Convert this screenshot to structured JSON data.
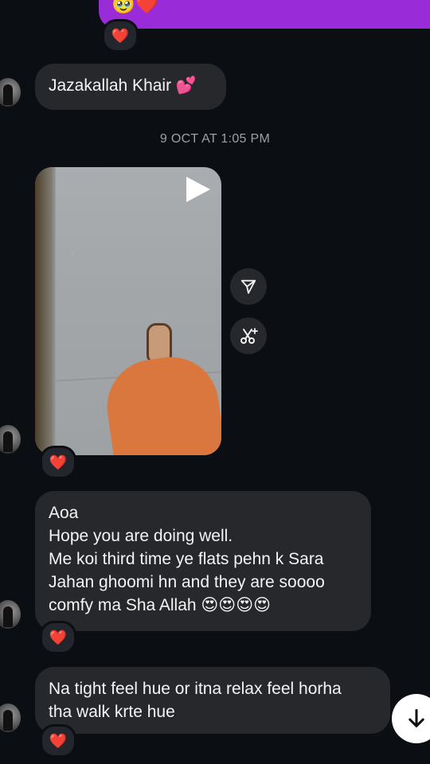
{
  "top_message": {
    "emojis": "🥹❤️"
  },
  "reaction": {
    "emoji": "❤️"
  },
  "messages": [
    {
      "lines": [
        "Jazakallah Khair 💕"
      ]
    },
    {
      "lines": [
        "Aoa",
        "Hope you are doing well.",
        "Me koi third time ye flats pehn k Sara",
        "Jahan ghoomi hn and they are soooo",
        "comfy ma Sha Allah 😍😍😍😍"
      ]
    },
    {
      "lines": [
        "Na tight feel hue or itna relax feel horha",
        "tha walk krte hue"
      ]
    }
  ],
  "timestamp": "9 OCT AT 1:05 PM",
  "icons": {
    "play": "play-icon",
    "share": "send-icon",
    "remix": "scissors-sparkle-icon",
    "scroll": "arrow-down-icon"
  }
}
